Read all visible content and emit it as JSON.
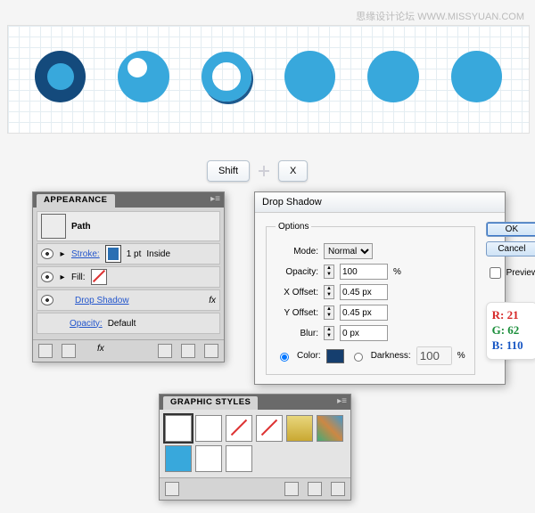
{
  "watermark": "思缘设计论坛  WWW.MISSYUAN.COM",
  "keys": {
    "shift": "Shift",
    "x": "X"
  },
  "appearance": {
    "title": "APPEARANCE",
    "object": "Path",
    "stroke_label": "Stroke:",
    "stroke_weight": "1 pt",
    "stroke_align": "Inside",
    "fill_label": "Fill:",
    "effect": "Drop Shadow",
    "opacity_label": "Opacity:",
    "opacity_value": "Default",
    "fx_icon": "fx"
  },
  "dialog": {
    "title": "Drop Shadow",
    "group": "Options",
    "mode_label": "Mode:",
    "mode_value": "Normal",
    "opacity_label": "Opacity:",
    "opacity_value": "100",
    "percent": "%",
    "xoff_label": "X Offset:",
    "xoff_value": "0.45 px",
    "yoff_label": "Y Offset:",
    "yoff_value": "0.45 px",
    "blur_label": "Blur:",
    "blur_value": "0 px",
    "color_label": "Color:",
    "darkness_label": "Darkness:",
    "darkness_value": "100",
    "ok": "OK",
    "cancel": "Cancel",
    "preview": "Preview",
    "rgb": {
      "r": "R: 21",
      "g": "G: 62",
      "b": "B: 110"
    }
  },
  "gstyles": {
    "title": "GRAPHIC STYLES"
  }
}
